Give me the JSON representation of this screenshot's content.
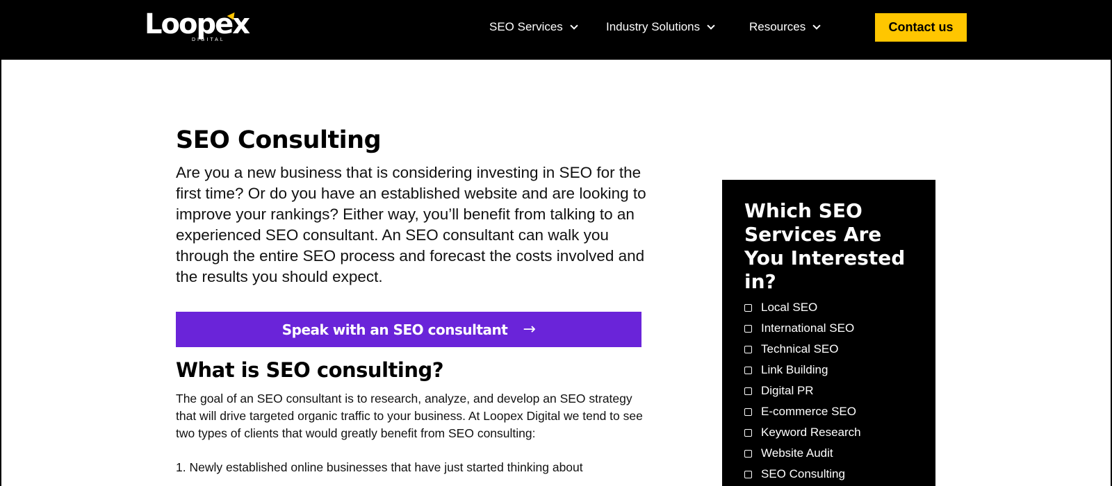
{
  "brand": {
    "name": "Loopex",
    "tagline": "DIGITAL",
    "accent_color": "#ffc600"
  },
  "nav": {
    "items": [
      {
        "label": "SEO Services",
        "icon": "chevron-down-icon"
      },
      {
        "label": "Industry Solutions",
        "icon": "chevron-down-icon"
      },
      {
        "label": "Resources",
        "icon": "chevron-down-icon"
      }
    ],
    "contact_label": "Contact us"
  },
  "main": {
    "title": "SEO Consulting",
    "intro": "Are you a new business that is considering investing in SEO for the first time? Or do you have an established website and are looking to improve your rankings? Either way, you’ll benefit from talking to an experienced SEO consultant. An SEO consultant can walk you through the entire SEO process and forecast the costs involved and the results you should expect.",
    "cta_label": "Speak with an SEO consultant",
    "cta_icon": "arrow-right-icon",
    "cta_color": "#6a24d9",
    "section_heading": "What is SEO consulting?",
    "section_paragraph": "The goal of an SEO consultant is to research, analyze, and develop an SEO strategy that will drive targeted organic traffic to your business. At Loopex Digital we tend to see two types of clients that would greatly benefit from SEO consulting:",
    "list_first": "1. Newly established online businesses that have just started thinking about"
  },
  "sidebar": {
    "title": "Which SEO Services Are You Interested in?",
    "options": [
      {
        "label": "Local SEO",
        "checked": false
      },
      {
        "label": "International SEO",
        "checked": false
      },
      {
        "label": "Technical SEO",
        "checked": false
      },
      {
        "label": "Link Building",
        "checked": false
      },
      {
        "label": "Digital PR",
        "checked": false
      },
      {
        "label": "E-commerce SEO",
        "checked": false
      },
      {
        "label": "Keyword Research",
        "checked": false
      },
      {
        "label": "Website Audit",
        "checked": false
      },
      {
        "label": "SEO Consulting",
        "checked": false
      }
    ]
  }
}
